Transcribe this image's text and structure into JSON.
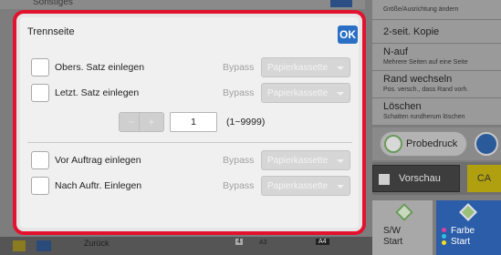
{
  "background": {
    "top_left_label": "Sonstiges",
    "right_panel": [
      {
        "main": "",
        "sub": "Größe/Ausrichtung ändern"
      },
      {
        "main": "2-seit. Kopie",
        "sub": ""
      },
      {
        "main": "N-auf",
        "sub": "Mehrere Seiten auf eine Seite"
      },
      {
        "main": "Rand wechseln",
        "sub": "Pos. versch., dass Rand vorh."
      },
      {
        "main": "Löschen",
        "sub": "Schatten rundherum löschen"
      }
    ],
    "proof_label": "Probedruck",
    "preview_label": "Vorschau",
    "ca_label": "CA",
    "sw_start": {
      "line1": "S/W",
      "line2": "Start"
    },
    "color_start": {
      "line1": "Farbe",
      "line2": "Start"
    },
    "bottom": {
      "back_label": "Zurück",
      "page_indicator": "4",
      "paper_a3": "A3",
      "paper_a4": "A4"
    }
  },
  "dialog": {
    "title": "Trennseite",
    "ok_label": "OK",
    "rows": [
      {
        "label": "Obers. Satz einlegen",
        "bypass": "Bypass",
        "select": "Papierkassette"
      },
      {
        "label": "Letzt. Satz einlegen",
        "bypass": "Bypass",
        "select": "Papierkassette"
      },
      {
        "label": "Vor Auftrag einlegen",
        "bypass": "Bypass",
        "select": "Papierkassette"
      },
      {
        "label": "Nach Auftr. Einlegen",
        "bypass": "Bypass",
        "select": "Papierkassette"
      }
    ],
    "stepper": {
      "value": "1",
      "range": "(1~9999)",
      "minus": "−",
      "plus": "+"
    }
  },
  "colors": {
    "highlight_border": "#e3122e",
    "ok_button": "#2a6fc4",
    "color_start_button": "#2c5da8"
  }
}
